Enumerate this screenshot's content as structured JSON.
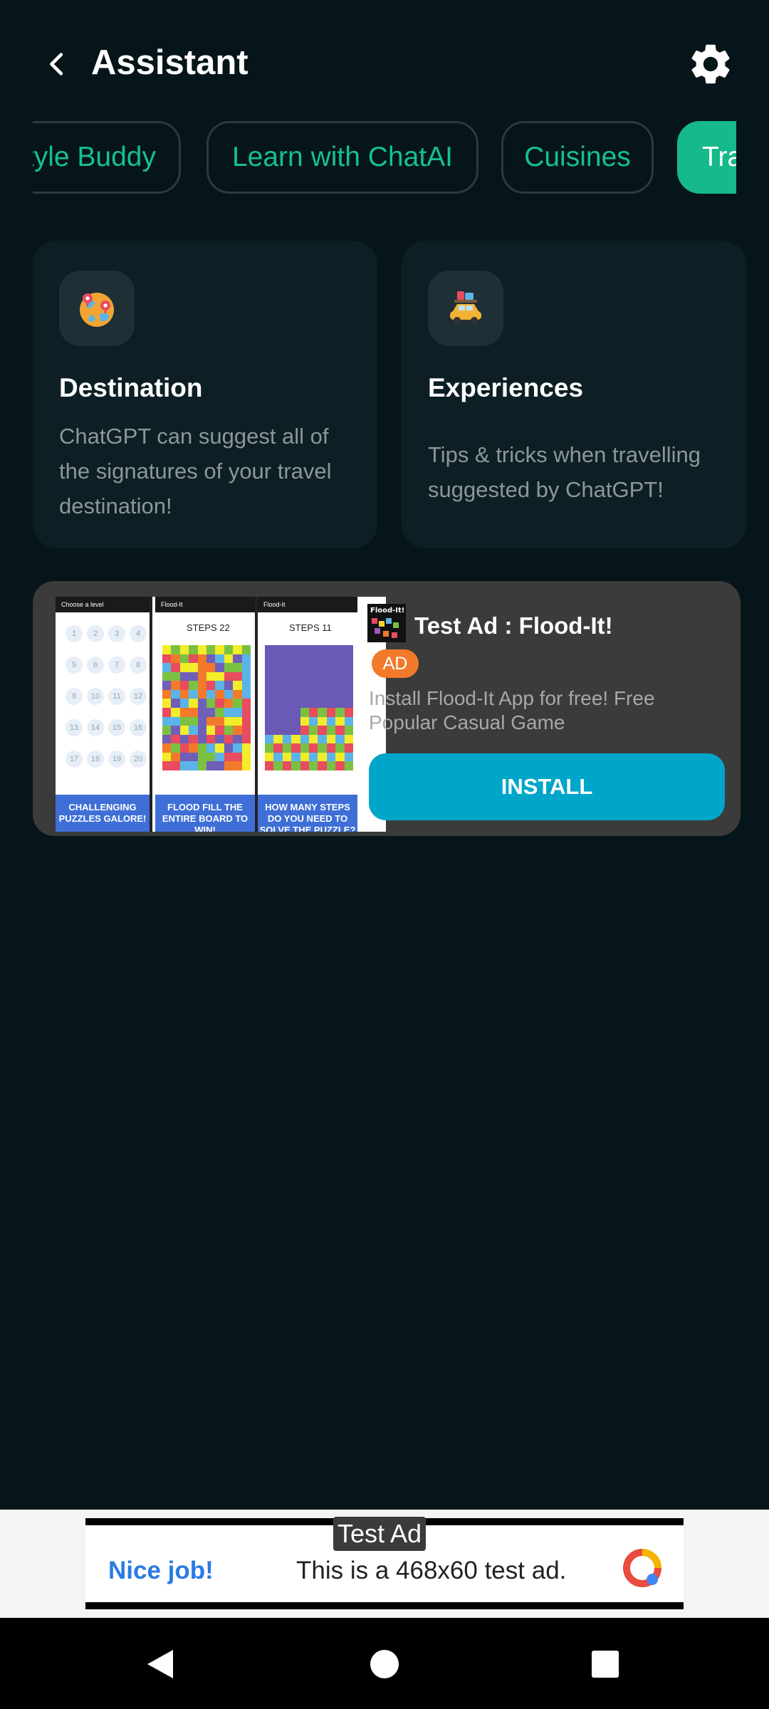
{
  "header": {
    "title": "Assistant"
  },
  "chips": [
    {
      "label": "Lifestyle Buddy"
    },
    {
      "label": "Learn with ChatAI"
    },
    {
      "label": "Cuisines"
    },
    {
      "label": "Travel"
    }
  ],
  "cards": [
    {
      "title": "Destination",
      "desc": "ChatGPT can suggest all of the signatures of your travel destination!",
      "icon": "globe-pin-icon"
    },
    {
      "title": "Experiences",
      "desc": "Tips & tricks when travelling suggested by ChatGPT!",
      "icon": "car-luggage-icon"
    }
  ],
  "native_ad": {
    "title": "Test Ad : Flood-It!",
    "badge": "AD",
    "desc": "Install Flood-It App for free! Free Popular Casual Game",
    "install_label": "INSTALL",
    "logo_text": "Flood-It!",
    "shots": [
      {
        "bar": "Choose a level",
        "caption": "CHALLENGING PUZZLES GALORE!",
        "levels": [
          "1",
          "2",
          "3",
          "4",
          "5",
          "6",
          "7",
          "8",
          "9",
          "10",
          "11",
          "12",
          "13",
          "14",
          "15",
          "16",
          "17",
          "18",
          "19",
          "20"
        ]
      },
      {
        "bar": "Flood-It",
        "steps": "STEPS 22",
        "caption": "FLOOD FILL THE ENTIRE BOARD TO WIN!"
      },
      {
        "bar": "Flood-It",
        "steps": "STEPS 11",
        "caption": "HOW MANY STEPS DO YOU NEED TO SOLVE THE PUZZLE?"
      }
    ]
  },
  "banner_ad": {
    "tag": "Test Ad",
    "nice": "Nice job!",
    "text": "This is a 468x60 test ad."
  },
  "colors": {
    "accent": "#15b98a",
    "install": "#00a6c9",
    "badge": "#f27a2a",
    "background": "#061519"
  }
}
